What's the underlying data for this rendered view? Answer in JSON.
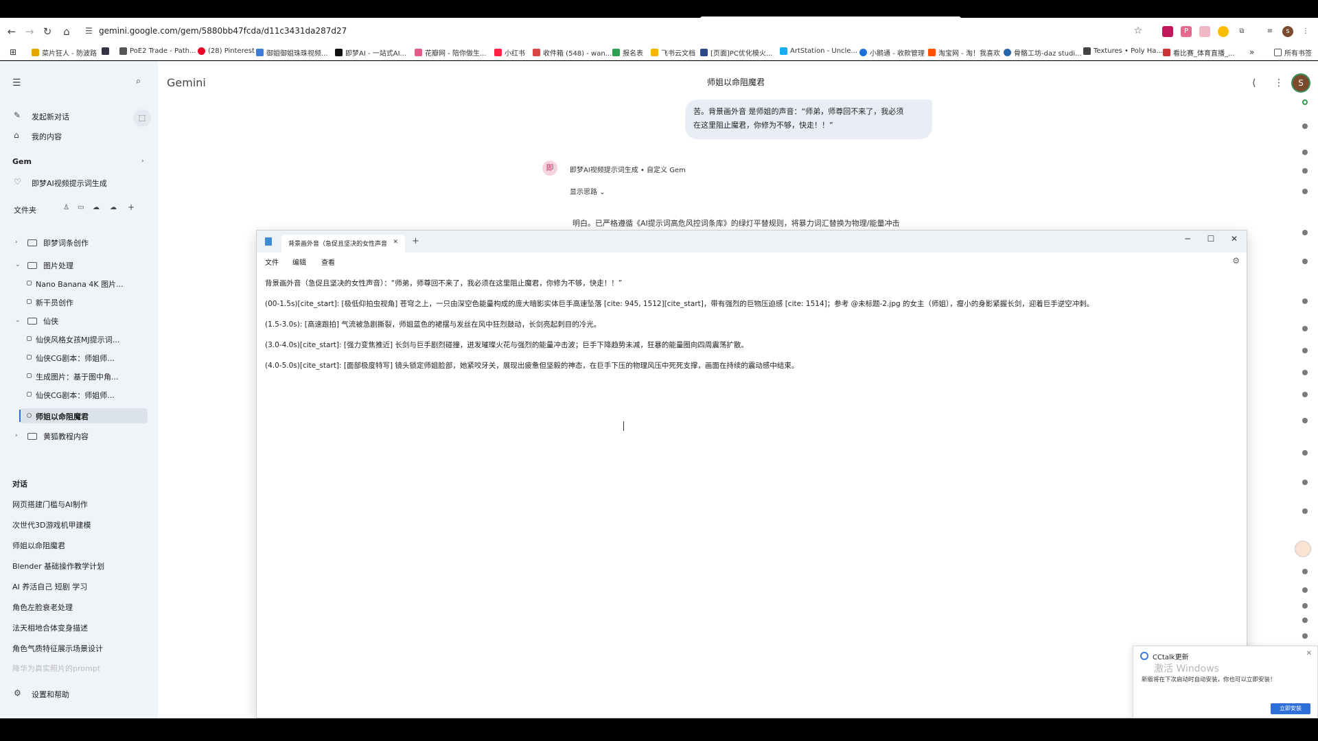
{
  "browser": {
    "url": "gemini.google.com/gem/5880bb47fcda/d11c3431da287d27",
    "bookmarks": [
      "菜片狂人 - 防波路",
      "PoE2 Trade - Path...",
      "(28) Pinterest",
      "御姐御姐珠珠视频...",
      "即梦AI - 一站式AI...",
      "花瓣网 - 陪你做生...",
      "小红书",
      "收件箱 (548) - wan...",
      "报名表",
      "飞书云文档",
      "[页面]PC优化模火...",
      "ArtStation - Uncle...",
      "小鹅通 - 收款管理",
      "淘宝网 - 淘！我喜欢",
      "骨骼工坊-daz studi...",
      "Textures • Poly Ha...",
      "看比赛_体育直播_..."
    ],
    "all_bookmarks": "所有书签",
    "more": "»"
  },
  "sidebar": {
    "new_chat": "发起新对话",
    "my_content": "我的内容",
    "gem_heading": "Gem",
    "gem_item": "即梦AI视频提示词生成",
    "folders_heading": "文件夹",
    "folders": [
      {
        "name": "即梦词条创作",
        "expanded": false,
        "items": []
      },
      {
        "name": "图片处理",
        "expanded": true,
        "items": [
          "Nano Banana 4K 图片...",
          "新干员创作"
        ]
      },
      {
        "name": "仙侠",
        "expanded": true,
        "items": [
          "仙侠风格女孩MJ提示词...",
          "仙侠CG剧本：师姐师...",
          "生成图片：基于图中角...",
          "仙侠CG剧本：师姐师...",
          "师姐以命阻魔君"
        ]
      },
      {
        "name": "黄狐教程内容",
        "expanded": false,
        "items": []
      }
    ],
    "chats_heading": "对话",
    "chats": [
      "网页搭建门槛与AI制作",
      "次世代3D游戏机甲建模",
      "师姐以命阻魔君",
      "Blender 基础操作教学计划",
      "AI 养活自己 短剧 学习",
      "角色左脸衰老处理",
      "法天相地合体变身描述",
      "角色气质特征展示场景设计",
      "降华为真实照片的prompt"
    ],
    "settings": "设置和帮助"
  },
  "main": {
    "app_name": "Gemini",
    "chat_title": "师姐以命阻魔君",
    "user_message_line1": "苦。背景画外音 是师姐的声音：“师弟，师尊回不来了，我必须",
    "user_message_line2": "在这里阻止魔君，你修为不够，快走！！”",
    "ai_avatar_letter": "即",
    "ai_name": "即梦AI视频提示词生成 • 自定义 Gem",
    "show_thinking": "显示思路",
    "reply_excerpt": "明白。已严格遵循《AI提示词高危风控词条库》的绿灯平替规则，将暴力词汇替换为物理/能量冲击",
    "profile_letter": "S"
  },
  "notepad": {
    "tab_title": "背景画外音（急促且坚决的女性声音",
    "menus": [
      "文件",
      "编辑",
      "查看"
    ],
    "lines": [
      "背景画外音（急促且坚决的女性声音）：“师弟，师尊回不来了，我必须在这里阻止魔君，你修为不够，快走！！”",
      "(00-1.5s)[cite_start]: [极低仰拍虫视角] 苍穹之上，一只由深空色能量构成的庞大暗影实体巨手高速坠落 [cite: 945, 1512][cite_start]，带有强烈的巨物压迫感 [cite: 1514]；参考 @未标题-2.jpg 的女主（师姐），瘦小的身影紧握长剑，迎着巨手逆空冲刺。",
      "(1.5-3.0s): [高速跟拍] 气流被急剧撕裂，师姐蓝色的裙摆与发丝在风中狂烈鼓动，长剑亮起刺目的冷光。",
      "(3.0-4.0s)[cite_start]: [强力变焦推近] 长剑与巨手剧烈碰撞，迸发璀璨火花与强烈的能量冲击波；巨手下降趋势未减，狂暴的能量圈向四周震荡扩散。",
      "(4.0-5.0s)[cite_start]: [面部极度特写] 镜头锁定师姐脸部，她紧咬牙关，展现出疲惫但坚毅的神态，在巨手下压的物理风压中死死支撑，画面在持续的震动感中结束。"
    ]
  },
  "toast": {
    "title": "CCtalk更新",
    "watermark": "激活 Windows",
    "message": "新版将在下次启动时自动安装，你也可以立即安装！",
    "button": "立即安装"
  },
  "colors": {
    "accent": "#2f6fd9",
    "sidebar_bg": "#f0f4f9",
    "bubble_bg": "#e9eef6"
  }
}
